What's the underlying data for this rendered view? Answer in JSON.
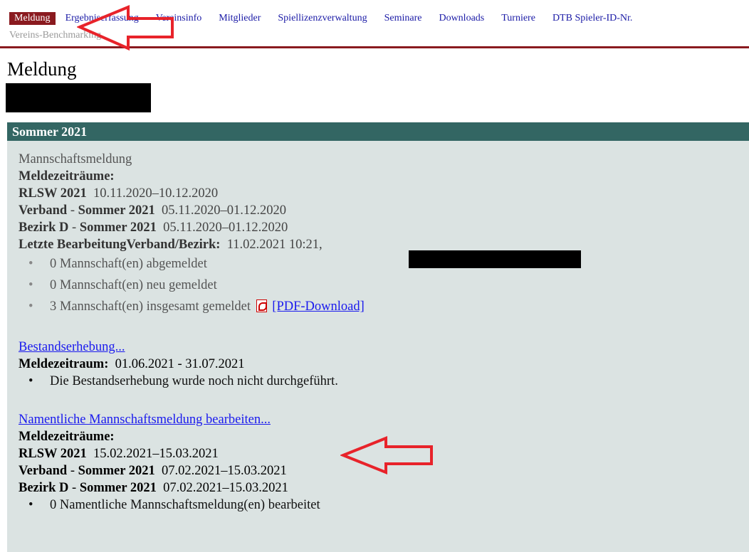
{
  "nav": {
    "items": [
      "Meldung",
      "Ergebniserfassung",
      "Vereinsinfo",
      "Mitglieder",
      "Spiellizenzverwaltung",
      "Seminare",
      "Downloads",
      "Turniere",
      "DTB Spieler-ID-Nr."
    ],
    "row2": "Vereins-Benchmarking"
  },
  "page": {
    "title": "Meldung"
  },
  "section": {
    "header": "Sommer 2021",
    "mannschaftsmeldung": {
      "title": "Mannschaftsmeldung",
      "periods_label": "Meldezeiträume:",
      "periods": [
        {
          "bold": "RLSW 2021",
          "value": "10.11.2020–10.12.2020"
        },
        {
          "bold": "Verband",
          "sep": " - ",
          "bold2": "Sommer 2021",
          "value": "05.11.2020–01.12.2020"
        },
        {
          "bold": "Bezirk D",
          "sep": " - ",
          "bold2": "Sommer 2021",
          "value": "05.11.2020–01.12.2020"
        }
      ],
      "last_edit_label": "Letzte BearbeitungVerband/Bezirk:",
      "last_edit_value": "11.02.2021 10:21,",
      "bullets": [
        "0 Mannschaft(en) abgemeldet",
        "0 Mannschaft(en) neu gemeldet",
        "3 Mannschaft(en) insgesamt gemeldet"
      ],
      "pdf_link": "[PDF-Download]",
      "pdf_icon": "pdf-icon"
    },
    "bestand": {
      "link": "Bestandserhebung...",
      "period_label": "Meldezeitraum:",
      "period_value": "01.06.2021 - 31.07.2021",
      "bullet": "Die Bestandserhebung wurde noch nicht durchgeführt."
    },
    "namentlich": {
      "link": "Namentliche Mannschaftsmeldung bearbeiten...",
      "periods_label": "Meldezeiträume:",
      "periods": [
        {
          "bold": "RLSW 2021",
          "value": "15.02.2021–15.03.2021"
        },
        {
          "bold": "Verband",
          "sep": " - ",
          "bold2": "Sommer 2021",
          "value": "07.02.2021–15.03.2021"
        },
        {
          "bold": "Bezirk D",
          "sep": " - ",
          "bold2": "Sommer 2021",
          "value": "07.02.2021–15.03.2021"
        }
      ],
      "bullet": "0 Namentliche Mannschaftsmeldung(en) bearbeitet"
    }
  },
  "colors": {
    "accent": "#8a1a1f",
    "header_bg": "#336663",
    "panel_bg": "#dbe3e2",
    "annotation": "#e8232a"
  }
}
